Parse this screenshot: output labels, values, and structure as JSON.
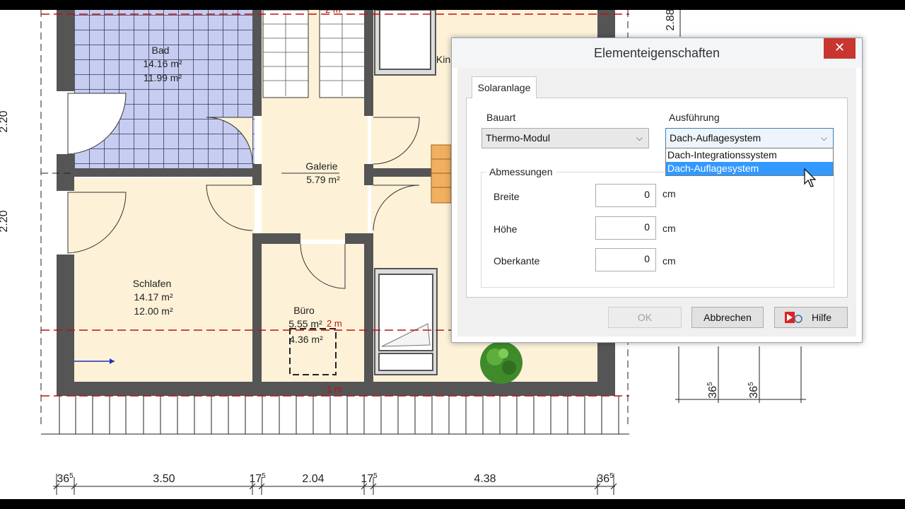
{
  "floorplan": {
    "rooms": [
      {
        "name": "Bad",
        "area1": "14.16 m²",
        "area2": "11.99 m²"
      },
      {
        "name": "Galerie",
        "area1": "5.79 m²"
      },
      {
        "name": "Schlafen",
        "area1": "14.17 m²",
        "area2": "12.00 m²"
      },
      {
        "name": "Büro",
        "area1": "5.55 m²",
        "area2": "4.36 m²"
      },
      {
        "name": "Kin"
      }
    ],
    "red_markers": [
      "2 m",
      "2 m",
      "1 m"
    ],
    "bottom_dimensions": [
      "36",
      "3.50",
      "17",
      "2.04",
      "17",
      "4.38",
      "36"
    ],
    "dimension_superscript": "5",
    "side_dimensions": [
      "2.88",
      "2.20",
      "2.20"
    ],
    "right_dimensions": [
      "36",
      "36"
    ]
  },
  "dialog": {
    "title": "Elementeigenschaften",
    "close_icon": "✕",
    "tab_label": "Solaranlage",
    "bauart": {
      "label": "Bauart",
      "value": "Thermo-Modul"
    },
    "ausfuehrung": {
      "label": "Ausführung",
      "value": "Dach-Auflagesystem",
      "options": [
        "Dach-Integrationssystem",
        "Dach-Auflagesystem"
      ]
    },
    "abmessungen": {
      "title": "Abmessungen",
      "breite": {
        "label": "Breite",
        "value": "0",
        "unit": "cm"
      },
      "hoehe": {
        "label": "Höhe",
        "value": "0",
        "unit": "cm"
      },
      "oberkante": {
        "label": "Oberkante",
        "value": "0",
        "unit": "cm"
      }
    },
    "buttons": {
      "ok": "OK",
      "cancel": "Abbrechen",
      "help": "Hilfe"
    },
    "colors": {
      "close": "#c7372f",
      "selection": "#3399ff"
    }
  }
}
